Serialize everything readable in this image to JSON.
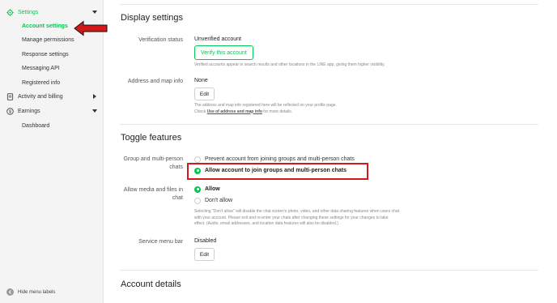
{
  "sidebar": {
    "settings_group": {
      "label": "Settings",
      "icon": "gear-icon"
    },
    "sub_items": [
      {
        "label": "Account settings",
        "active": true
      },
      {
        "label": "Manage permissions",
        "active": false
      },
      {
        "label": "Response settings",
        "active": false
      },
      {
        "label": "Messaging API",
        "active": false
      },
      {
        "label": "Registered info",
        "active": false
      }
    ],
    "activity_group": {
      "label": "Activity and billing",
      "icon": "document-icon"
    },
    "earnings_group": {
      "label": "Earnings",
      "icon": "dollar-icon"
    },
    "earnings_sub": [
      {
        "label": "Dashboard"
      }
    ],
    "hide_labels": "Hide menu labels"
  },
  "display_settings": {
    "title": "Display settings",
    "verification": {
      "label": "Verification status",
      "value": "Unverified account",
      "button": "Verify this account",
      "note": "Verified accounts appear in search results and other locations in the LINE app, giving them higher visibility."
    },
    "address": {
      "label": "Address and map info",
      "value": "None",
      "button": "Edit",
      "note_line1": "The address and map info registered here will be reflected on your profile page.",
      "note_line2_pre": "Check ",
      "note_link": "Use of address and map info",
      "note_line2_post": " for more details."
    }
  },
  "toggle_features": {
    "title": "Toggle features",
    "group_chats": {
      "label": "Group and multi-person chats",
      "options": [
        {
          "label": "Prevent account from joining groups and multi-person chats",
          "checked": false
        },
        {
          "label": "Allow account to join groups and multi-person chats",
          "checked": true
        }
      ]
    },
    "media": {
      "label": "Allow media and files in chat",
      "options": [
        {
          "label": "Allow",
          "checked": true
        },
        {
          "label": "Don't allow",
          "checked": false
        }
      ],
      "note": "Selecting \"Don't allow\" will disable the chat screen's photo, video, and other data sharing features when users chat with your account. Please exit and re-enter your chats after changing these settings for your changes to take effect. (Audio, email addresses, and location data features will also be disabled.)"
    },
    "service_menu": {
      "label": "Service menu bar",
      "value": "Disabled",
      "button": "Edit"
    }
  },
  "account_details": {
    "title": "Account details"
  },
  "colors": {
    "accent": "#06c755",
    "annotation": "#d31a1a"
  }
}
